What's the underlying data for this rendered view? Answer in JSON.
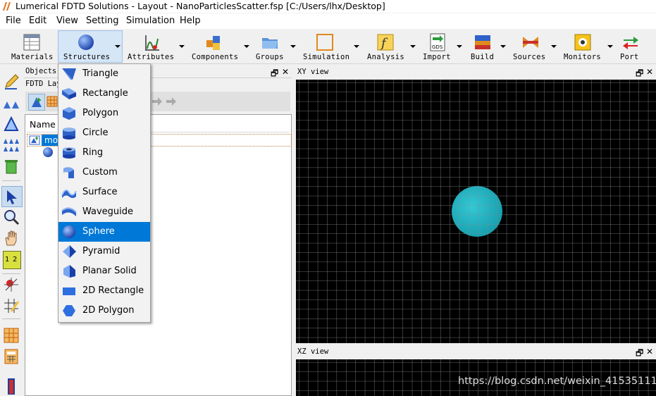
{
  "window": {
    "title": "Lumerical FDTD Solutions - Layout - NanoParticlesScatter.fsp [C:/Users/lhx/Desktop]"
  },
  "menubar": [
    "File",
    "Edit",
    "View",
    "Setting",
    "Simulation",
    "Help"
  ],
  "toolbar": {
    "materials": "Materials",
    "structures": "Structures",
    "attributes": "Attributes",
    "components": "Components",
    "groups": "Groups",
    "simulation": "Simulation",
    "analysis": "Analysis",
    "import": "Import",
    "build": "Build",
    "sources": "Sources",
    "monitors": "Monitors",
    "port": "Port",
    "import_badge": "GDS"
  },
  "objects_panel": {
    "title": "Objects",
    "subtitle": "FDTD Lay",
    "tree_header": "Name",
    "model_label": "mo"
  },
  "structures_menu": {
    "items": [
      "Triangle",
      "Rectangle",
      "Polygon",
      "Circle",
      "Ring",
      "Custom",
      "Surface",
      "Waveguide",
      "Sphere",
      "Pyramid",
      "Planar Solid",
      "2D Rectangle",
      "2D Polygon"
    ],
    "selected": "Sphere"
  },
  "views": {
    "xy_title": "XY view",
    "xz_title": "XZ view"
  },
  "lefttool_ruler": {
    "a": "1",
    "b": "2"
  },
  "watermark": "https://blog.csdn.net/weixin_41535111",
  "colors": {
    "accent": "#0078d7",
    "sphere": "#1fb5c4",
    "grid": "#8a8a8a"
  }
}
